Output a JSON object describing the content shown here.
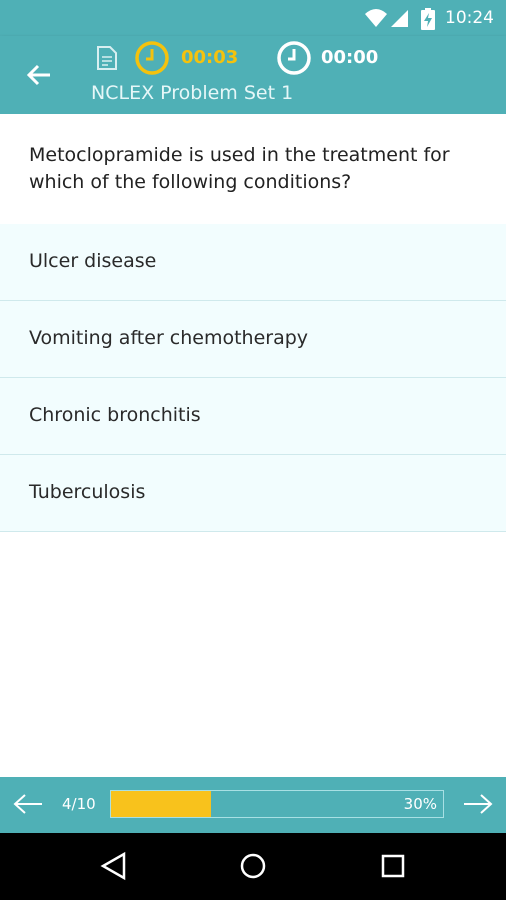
{
  "status_bar": {
    "time": "10:24",
    "icons": [
      "wifi-icon",
      "signal-icon",
      "battery-charging-icon"
    ]
  },
  "header": {
    "title": "NCLEX Problem Set 1",
    "question_timer": "00:03",
    "total_timer": "00:00",
    "accent_color": "#f4c20d",
    "bar_color": "#4fb0b6"
  },
  "question": {
    "text": "Metoclopramide is used in the treatment for which of the following conditions?"
  },
  "options": [
    {
      "label": "Ulcer disease"
    },
    {
      "label": "Vomiting after chemotherapy"
    },
    {
      "label": "Chronic bronchitis"
    },
    {
      "label": "Tuberculosis"
    }
  ],
  "footer": {
    "counter": "4/10",
    "progress_fraction": 0.3,
    "progress_label": "30%"
  }
}
